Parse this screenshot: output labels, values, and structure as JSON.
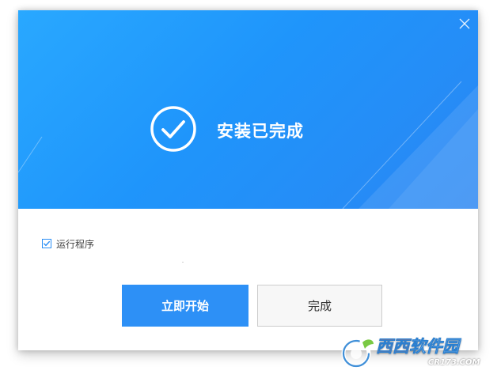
{
  "installer": {
    "headline": "安装已完成",
    "close_icon": "close-icon",
    "status_icon": "check-circle-icon",
    "run_after": {
      "label": "运行程序",
      "checked": true
    },
    "buttons": {
      "start_label": "立即开始",
      "finish_label": "完成"
    },
    "colors": {
      "banner": "#1f95fb",
      "primary_button": "#2d90f6",
      "checkbox": "#2a8ff5"
    }
  },
  "watermark": {
    "title_part1": "西西",
    "title_part2": "软件园",
    "url": "CR173.COM"
  }
}
